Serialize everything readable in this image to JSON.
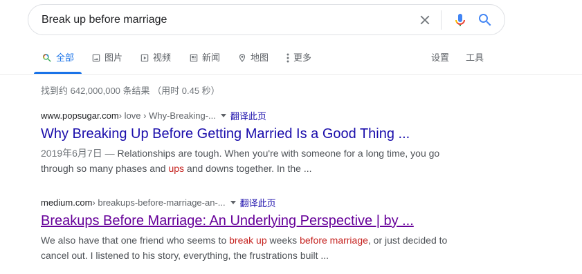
{
  "search": {
    "query": "Break up before marriage"
  },
  "icons": {
    "clear": "close-icon",
    "mic": "microphone-icon",
    "search": "search-icon"
  },
  "colors": {
    "link": "#1a0dab",
    "visited": "#660099",
    "active_tab": "#1a73e8",
    "highlight": "#c5221f"
  },
  "tabs": [
    {
      "label": "全部",
      "icon": "search-icon",
      "active": true
    },
    {
      "label": "图片",
      "icon": "image-icon",
      "active": false
    },
    {
      "label": "视频",
      "icon": "play-icon",
      "active": false
    },
    {
      "label": "新闻",
      "icon": "news-icon",
      "active": false
    },
    {
      "label": "地图",
      "icon": "location-pin-icon",
      "active": false
    },
    {
      "label": "更多",
      "icon": "more-vert-icon",
      "active": false
    }
  ],
  "tools": {
    "settings_label": "设置",
    "tools_label": "工具"
  },
  "stats": "找到约 642,000,000 条结果 （用时 0.45 秒）",
  "results": [
    {
      "domain": "www.popsugar.com",
      "path": " › love › Why-Breaking-...",
      "translate": "翻译此页",
      "title": "Why Breaking Up Before Getting Married Is a Good Thing ...",
      "visited": false,
      "snippet": {
        "date": "2019年6月7日 — ",
        "text_1": "Relationships are tough. When you're with someone for a long time, you go through so many phases and ",
        "hl_1": "ups",
        "text_2": " and downs together. In the ..."
      }
    },
    {
      "domain": "medium.com",
      "path": " › breakups-before-marriage-an-...",
      "translate": "翻译此页",
      "title": "Breakups Before Marriage: An Underlying Perspective | by ...",
      "visited": true,
      "snippet": {
        "text_1": "We also have that one friend who seems to ",
        "hl_1": "break up",
        "text_2": " weeks ",
        "hl_2": "before marriage",
        "text_3": ", or just decided to cancel out. I listened to his story, everything, the frustrations built ..."
      }
    }
  ]
}
